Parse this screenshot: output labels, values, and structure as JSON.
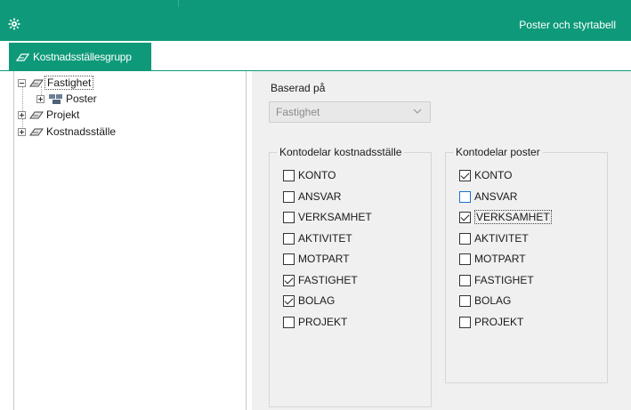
{
  "window": {
    "title": "Poster och styrtabell"
  },
  "tab": {
    "label": "Kostnadsställesgrupp"
  },
  "tree": {
    "nodes": [
      {
        "label": "Fastighet"
      },
      {
        "label": "Poster"
      },
      {
        "label": "Projekt"
      },
      {
        "label": "Kostnadsställe"
      }
    ]
  },
  "based_on": {
    "label": "Baserad på",
    "value": "Fastighet"
  },
  "groups": {
    "left": {
      "title": "Kontodelar kostnadsställe",
      "items": [
        {
          "label": "KONTO",
          "checked": false
        },
        {
          "label": "ANSVAR",
          "checked": false
        },
        {
          "label": "VERKSAMHET",
          "checked": false
        },
        {
          "label": "AKTIVITET",
          "checked": false
        },
        {
          "label": "MOTPART",
          "checked": false
        },
        {
          "label": "FASTIGHET",
          "checked": true
        },
        {
          "label": "BOLAG",
          "checked": true
        },
        {
          "label": "PROJEKT",
          "checked": false
        }
      ]
    },
    "right": {
      "title": "Kontodelar poster",
      "items": [
        {
          "label": "KONTO",
          "checked": true
        },
        {
          "label": "ANSVAR",
          "checked": false
        },
        {
          "label": "VERKSAMHET",
          "checked": true
        },
        {
          "label": "AKTIVITET",
          "checked": false
        },
        {
          "label": "MOTPART",
          "checked": false
        },
        {
          "label": "FASTIGHET",
          "checked": false
        },
        {
          "label": "BOLAG",
          "checked": false
        },
        {
          "label": "PROJEKT",
          "checked": false
        }
      ]
    }
  },
  "colors": {
    "accent": "#0e9a7a",
    "panel": "#f0f0f0"
  }
}
